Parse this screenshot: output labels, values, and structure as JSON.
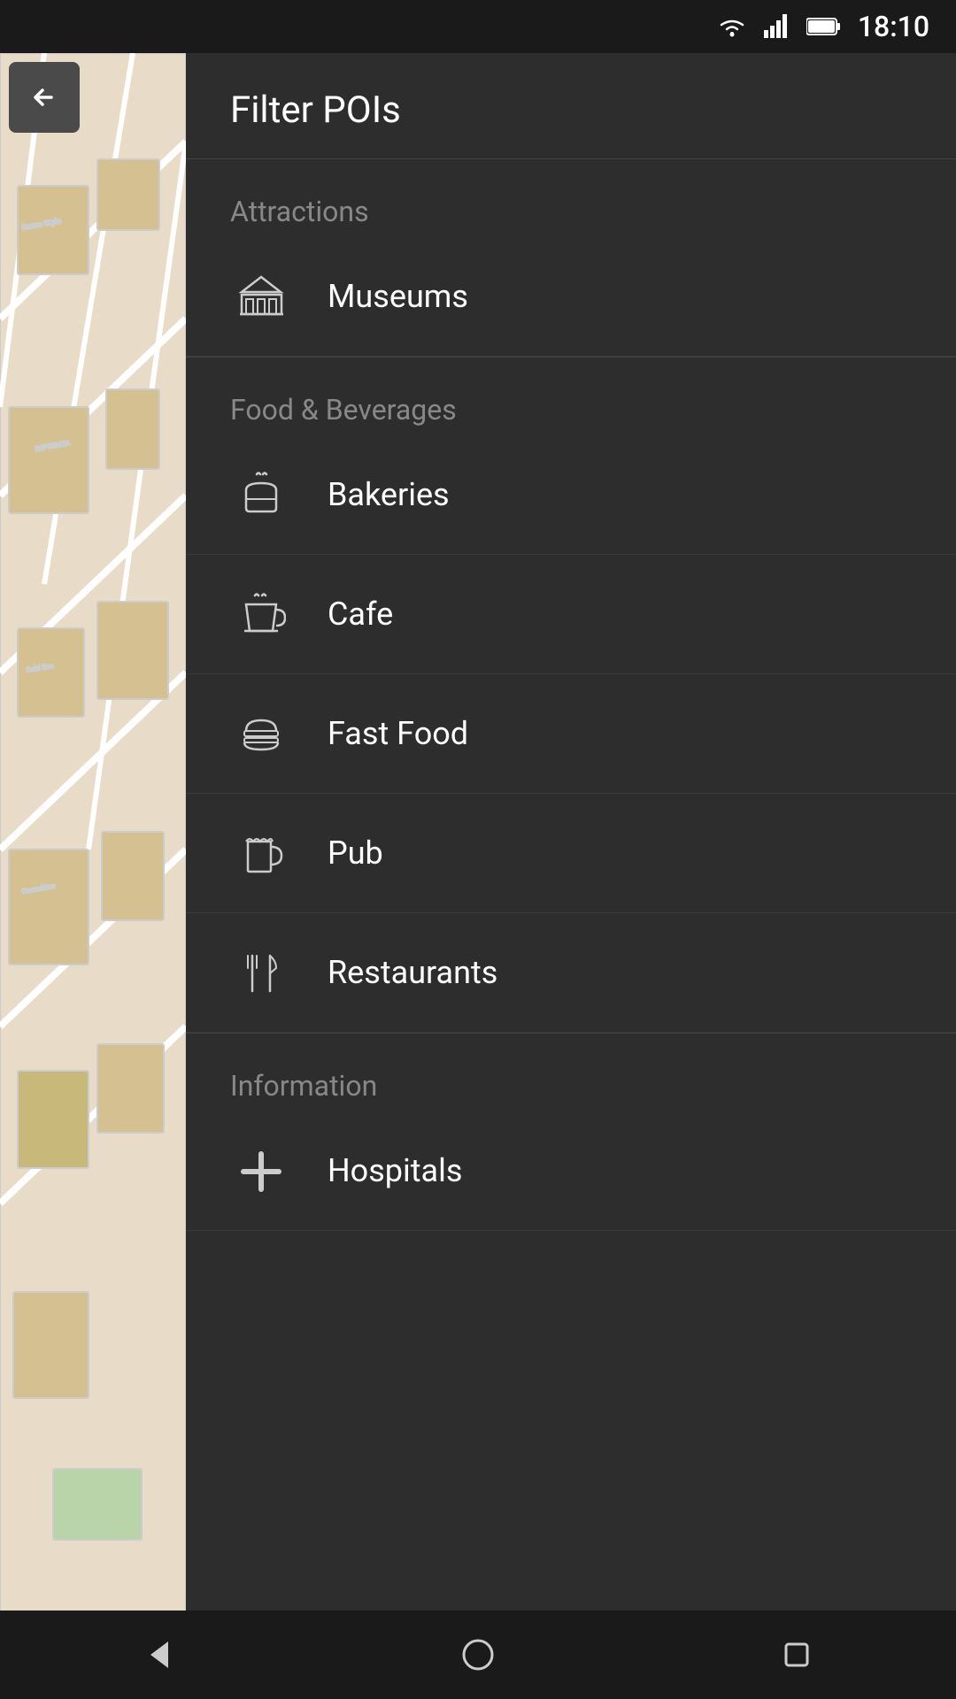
{
  "statusBar": {
    "time": "18:10"
  },
  "header": {
    "title": "Filter POIs",
    "backButton": "←"
  },
  "sections": [
    {
      "id": "attractions",
      "label": "Attractions",
      "items": [
        {
          "id": "museums",
          "label": "Museums",
          "icon": "museum"
        }
      ]
    },
    {
      "id": "food-beverages",
      "label": "Food & Beverages",
      "items": [
        {
          "id": "bakeries",
          "label": "Bakeries",
          "icon": "bakery"
        },
        {
          "id": "cafe",
          "label": "Cafe",
          "icon": "cafe"
        },
        {
          "id": "fast-food",
          "label": "Fast Food",
          "icon": "fastfood"
        },
        {
          "id": "pub",
          "label": "Pub",
          "icon": "pub"
        },
        {
          "id": "restaurants",
          "label": "Restaurants",
          "icon": "restaurant"
        }
      ]
    },
    {
      "id": "information",
      "label": "Information",
      "items": [
        {
          "id": "hospitals",
          "label": "Hospitals",
          "icon": "hospital"
        }
      ]
    }
  ],
  "bottomNav": {
    "back": "back",
    "home": "home",
    "recents": "recents"
  }
}
